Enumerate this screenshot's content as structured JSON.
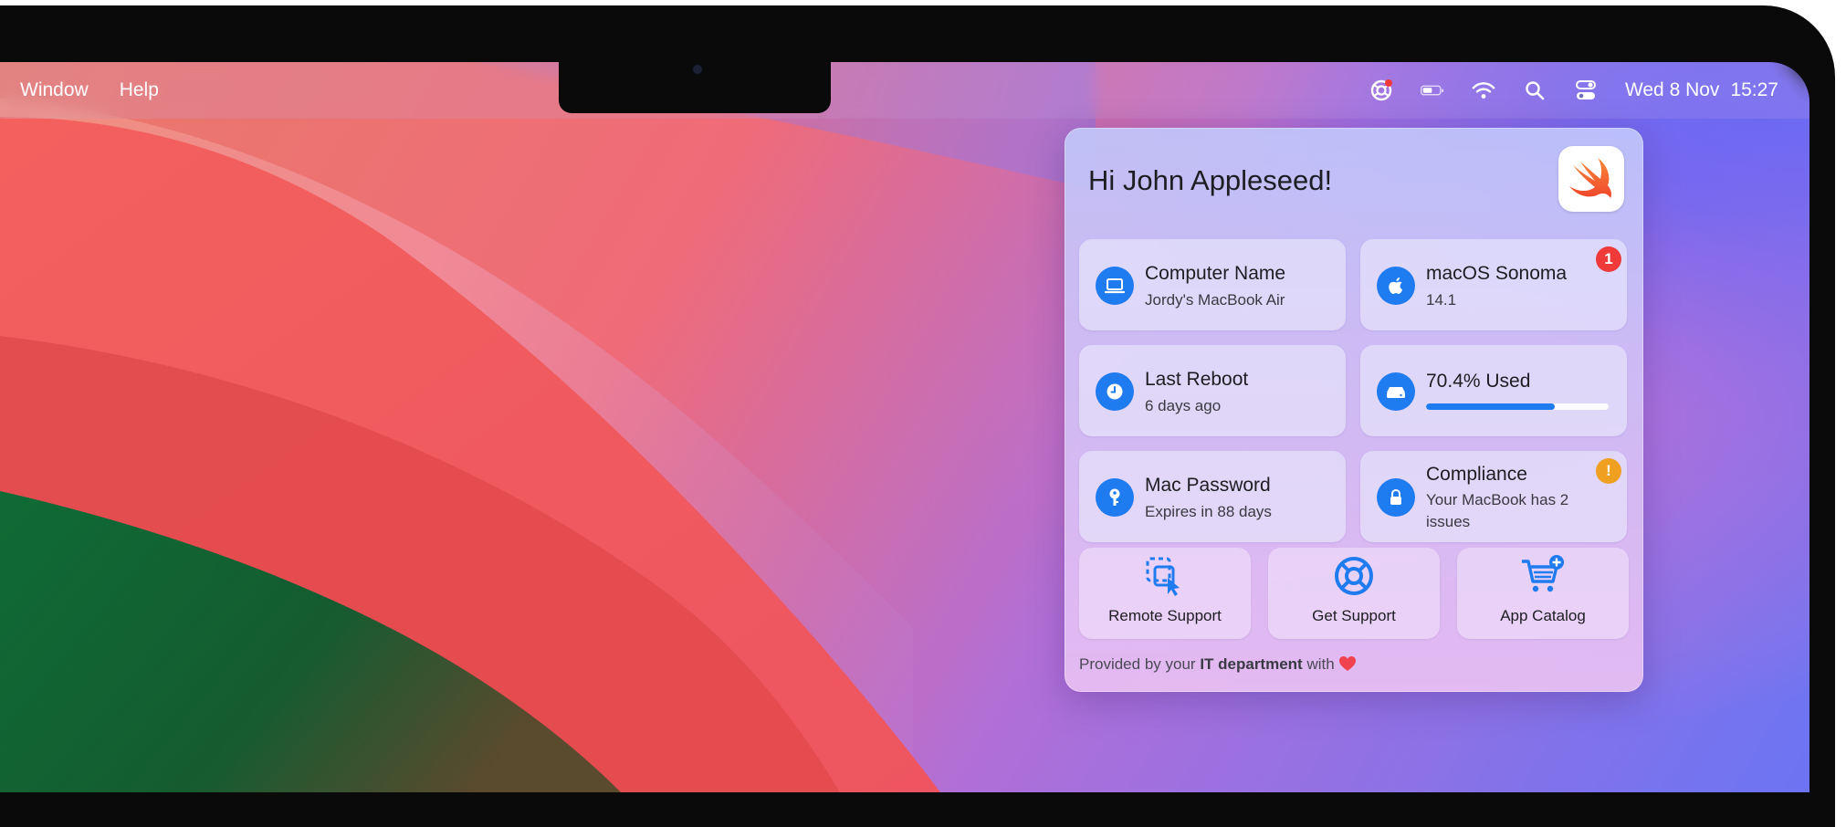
{
  "menubar": {
    "items": [
      "Window",
      "Help"
    ],
    "date": "Wed 8 Nov",
    "time": "15:27",
    "icons": [
      "support-lifebuoy-icon",
      "battery-icon",
      "wifi-icon",
      "search-icon",
      "control-center-icon"
    ]
  },
  "panel": {
    "greeting": "Hi John Appleseed!",
    "logo": "swift-logo-icon",
    "tiles": [
      {
        "title": "Computer Name",
        "subtitle": "Jordy's MacBook Air",
        "icon": "laptop-icon"
      },
      {
        "title": "macOS Sonoma",
        "subtitle": "14.1",
        "icon": "apple-icon",
        "badge": "1",
        "badge_color": "#f03a3a"
      },
      {
        "title": "Last Reboot",
        "subtitle": "6 days ago",
        "icon": "clock-icon"
      },
      {
        "title": "70.4% Used",
        "icon": "disk-icon",
        "progress": 0.704
      },
      {
        "title": "Mac Password",
        "subtitle": "Expires in 88 days",
        "icon": "key-icon"
      },
      {
        "title": "Compliance",
        "subtitle": "Your MacBook has 2 issues",
        "icon": "lock-icon",
        "badge": "!",
        "badge_color": "#f0a020"
      }
    ],
    "actions": [
      {
        "label": "Remote Support",
        "icon": "remote-support-icon"
      },
      {
        "label": "Get Support",
        "icon": "lifebuoy-icon"
      },
      {
        "label": "App Catalog",
        "icon": "cart-plus-icon"
      }
    ],
    "footer": {
      "prefix": "Provided by your",
      "bold": "IT department",
      "suffix": "with",
      "emoji": "❤️"
    }
  },
  "colors": {
    "accent": "#1f7bf0",
    "alert_red": "#f03a3a",
    "warning_orange": "#f0a020"
  }
}
